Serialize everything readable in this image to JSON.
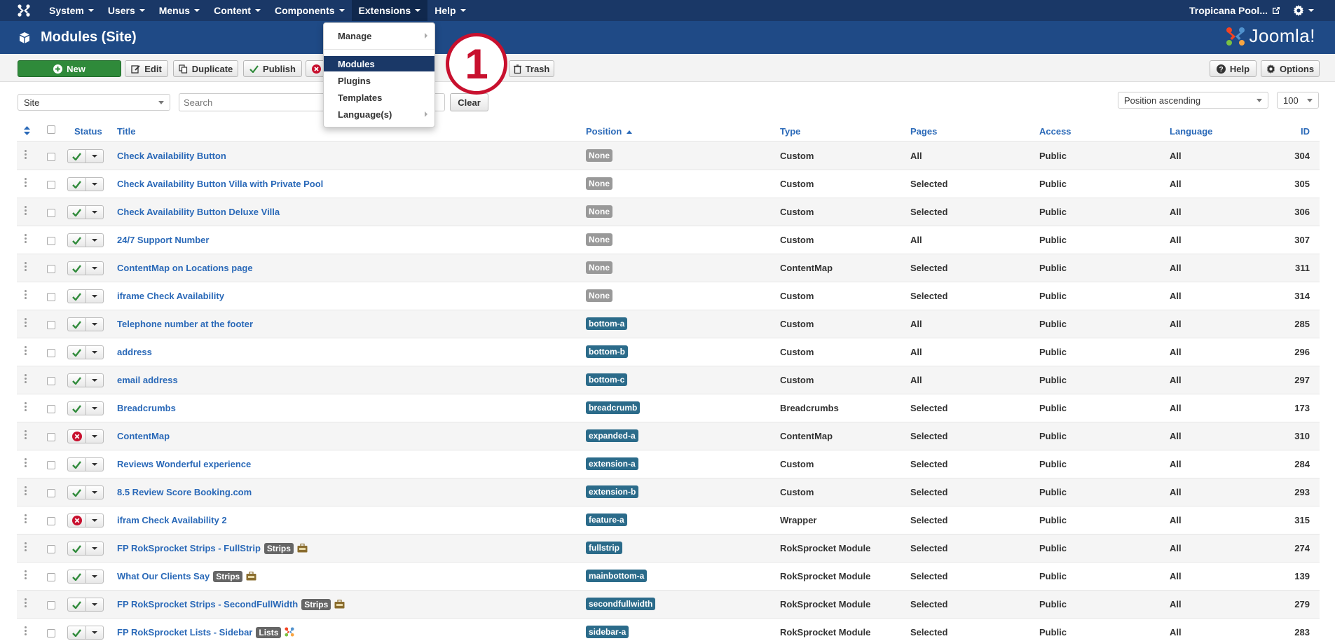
{
  "topnav": {
    "menus": [
      "System",
      "Users",
      "Menus",
      "Content",
      "Components",
      "Extensions",
      "Help"
    ],
    "active": "Extensions",
    "site_name": "Tropicana Pool..."
  },
  "header": {
    "title": "Modules (Site)",
    "brand": "Joomla!"
  },
  "toolbar": {
    "new_label": "New",
    "edit_label": "Edit",
    "duplicate_label": "Duplicate",
    "publish_label": "Publish",
    "trash_label": "Trash",
    "help_label": "Help",
    "options_label": "Options"
  },
  "filters": {
    "client_value": "Site",
    "search_placeholder": "Search",
    "clear_label": "Clear",
    "ordering_value": "Position ascending",
    "limit_value": "100"
  },
  "extensions_menu": {
    "items": [
      "Manage",
      "Modules",
      "Plugins",
      "Templates",
      "Language(s)"
    ],
    "active": "Modules"
  },
  "callout": {
    "number": "1"
  },
  "table": {
    "headers": {
      "status": "Status",
      "title": "Title",
      "position": "Position",
      "type": "Type",
      "pages": "Pages",
      "access": "Access",
      "language": "Language",
      "id": "ID"
    },
    "rows": [
      {
        "published": true,
        "title": "Check Availability Button",
        "tag": "",
        "position": "None",
        "type": "Custom",
        "pages": "All",
        "access": "Public",
        "language": "All",
        "id": "304"
      },
      {
        "published": true,
        "title": "Check Availability Button Villa with Private Pool",
        "tag": "",
        "position": "None",
        "type": "Custom",
        "pages": "Selected",
        "access": "Public",
        "language": "All",
        "id": "305"
      },
      {
        "published": true,
        "title": "Check Availability Button Deluxe Villa",
        "tag": "",
        "position": "None",
        "type": "Custom",
        "pages": "Selected",
        "access": "Public",
        "language": "All",
        "id": "306"
      },
      {
        "published": true,
        "title": "24/7 Support Number",
        "tag": "",
        "position": "None",
        "type": "Custom",
        "pages": "All",
        "access": "Public",
        "language": "All",
        "id": "307"
      },
      {
        "published": true,
        "title": "ContentMap on Locations page",
        "tag": "",
        "position": "None",
        "type": "ContentMap",
        "pages": "Selected",
        "access": "Public",
        "language": "All",
        "id": "311"
      },
      {
        "published": true,
        "title": "iframe Check Availability",
        "tag": "",
        "position": "None",
        "type": "Custom",
        "pages": "Selected",
        "access": "Public",
        "language": "All",
        "id": "314"
      },
      {
        "published": true,
        "title": "Telephone number at the footer",
        "tag": "",
        "position": "bottom-a",
        "type": "Custom",
        "pages": "All",
        "access": "Public",
        "language": "All",
        "id": "285"
      },
      {
        "published": true,
        "title": "address",
        "tag": "",
        "position": "bottom-b",
        "type": "Custom",
        "pages": "All",
        "access": "Public",
        "language": "All",
        "id": "296"
      },
      {
        "published": true,
        "title": "email address",
        "tag": "",
        "position": "bottom-c",
        "type": "Custom",
        "pages": "All",
        "access": "Public",
        "language": "All",
        "id": "297"
      },
      {
        "published": true,
        "title": "Breadcrumbs",
        "tag": "",
        "position": "breadcrumb",
        "type": "Breadcrumbs",
        "pages": "Selected",
        "access": "Public",
        "language": "All",
        "id": "173"
      },
      {
        "published": false,
        "title": "ContentMap",
        "tag": "",
        "position": "expanded-a",
        "type": "ContentMap",
        "pages": "Selected",
        "access": "Public",
        "language": "All",
        "id": "310"
      },
      {
        "published": true,
        "title": "Reviews Wonderful experience",
        "tag": "",
        "position": "extension-a",
        "type": "Custom",
        "pages": "Selected",
        "access": "Public",
        "language": "All",
        "id": "284"
      },
      {
        "published": true,
        "title": "8.5 Review Score Booking.com",
        "tag": "",
        "position": "extension-b",
        "type": "Custom",
        "pages": "Selected",
        "access": "Public",
        "language": "All",
        "id": "293"
      },
      {
        "published": false,
        "title": "ifram Check Availability 2",
        "tag": "",
        "position": "feature-a",
        "type": "Wrapper",
        "pages": "Selected",
        "access": "Public",
        "language": "All",
        "id": "315"
      },
      {
        "published": true,
        "title": "FP RokSprocket Strips - FullStrip",
        "tag": "Strips",
        "icon": "briefcase-icon",
        "position": "fullstrip",
        "type": "RokSprocket Module",
        "pages": "Selected",
        "access": "Public",
        "language": "All",
        "id": "274"
      },
      {
        "published": true,
        "title": "What Our Clients Say",
        "tag": "Strips",
        "icon": "briefcase-icon",
        "position": "mainbottom-a",
        "type": "RokSprocket Module",
        "pages": "Selected",
        "access": "Public",
        "language": "All",
        "id": "139"
      },
      {
        "published": true,
        "title": "FP RokSprocket Strips - SecondFullWidth",
        "tag": "Strips",
        "icon": "briefcase-icon",
        "position": "secondfullwidth",
        "type": "RokSprocket Module",
        "pages": "Selected",
        "access": "Public",
        "language": "All",
        "id": "279"
      },
      {
        "published": true,
        "title": "FP RokSprocket Lists - Sidebar",
        "tag": "Lists",
        "icon": "joomla-icon",
        "position": "sidebar-a",
        "type": "RokSprocket Module",
        "pages": "Selected",
        "access": "Public",
        "language": "All",
        "id": "283"
      }
    ]
  },
  "colors": {
    "nav_bg": "#1a3867",
    "header_bg": "#1f4a86",
    "link": "#2a69b8",
    "published": "#2f8a3a",
    "unpublished": "#c8102e",
    "position_tag": "#2b6b8a",
    "none_tag": "#999999"
  }
}
